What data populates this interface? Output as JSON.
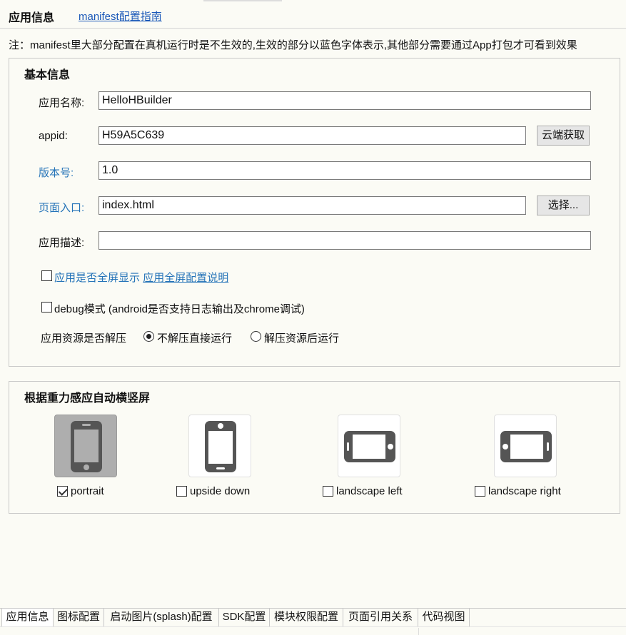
{
  "header": {
    "title": "应用信息",
    "guide_link": "manifest配置指南"
  },
  "note": "注：manifest里大部分配置在真机运行时是不生效的,生效的部分以蓝色字体表示,其他部分需要通过App打包才可看到效果",
  "basic_info": {
    "title": "基本信息",
    "app_name": {
      "label": "应用名称:",
      "value": "HelloHBuilder"
    },
    "appid": {
      "label": "appid:",
      "value": "H59A5C639",
      "button": "云端获取"
    },
    "version": {
      "label": "版本号:",
      "value": "1.0"
    },
    "entry": {
      "label": "页面入口:",
      "value": "index.html",
      "button": "选择..."
    },
    "description": {
      "label": "应用描述:",
      "value": ""
    },
    "fullscreen": {
      "label": "应用是否全屏显示",
      "link": "应用全屏配置说明",
      "checked": false
    },
    "debug": {
      "label": "debug模式 (android是否支持日志输出及chrome调试)",
      "checked": false
    },
    "unpack": {
      "label": "应用资源是否解压",
      "options": [
        {
          "label": "不解压直接运行",
          "selected": true
        },
        {
          "label": "解压资源后运行",
          "selected": false
        }
      ]
    }
  },
  "orientation": {
    "title": "根据重力感应自动横竖屏",
    "items": [
      {
        "label": "portrait",
        "checked": true,
        "icon": "phone-portrait-icon"
      },
      {
        "label": "upside down",
        "checked": false,
        "icon": "phone-upside-down-icon"
      },
      {
        "label": "landscape left",
        "checked": false,
        "icon": "phone-landscape-left-icon"
      },
      {
        "label": "landscape right",
        "checked": false,
        "icon": "phone-landscape-right-icon"
      }
    ]
  },
  "tabs": [
    {
      "label": "应用信息",
      "active": true
    },
    {
      "label": "图标配置",
      "active": false
    },
    {
      "label": "启动图片(splash)配置",
      "active": false
    },
    {
      "label": "SDK配置",
      "active": false
    },
    {
      "label": "模块权限配置",
      "active": false
    },
    {
      "label": "页面引用关系",
      "active": false
    },
    {
      "label": "代码视图",
      "active": false
    }
  ],
  "colors": {
    "link": "#1a58b8",
    "effective_label": "#2473b8",
    "selected_tile": "#aeaeae"
  }
}
